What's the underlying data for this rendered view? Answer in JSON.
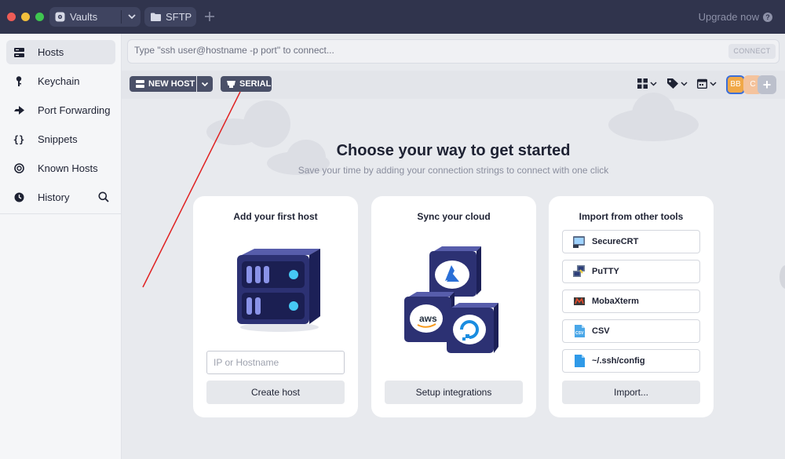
{
  "titlebar": {
    "tabs": [
      {
        "label": "Vaults",
        "icon": "vault-icon"
      },
      {
        "label": "SFTP",
        "icon": "folder-icon"
      }
    ],
    "new_tab_icon": "plus-icon",
    "upgrade_label": "Upgrade now"
  },
  "sidebar": {
    "items": [
      {
        "label": "Hosts",
        "icon": "hosts-icon",
        "active": true
      },
      {
        "label": "Keychain",
        "icon": "key-icon"
      },
      {
        "label": "Port Forwarding",
        "icon": "port-forwarding-icon"
      },
      {
        "label": "Snippets",
        "icon": "snippets-icon"
      },
      {
        "label": "Known Hosts",
        "icon": "known-hosts-icon"
      },
      {
        "label": "History",
        "icon": "history-icon"
      }
    ]
  },
  "command_bar": {
    "placeholder": "Type \"ssh user@hostname -p port\" to connect...",
    "connect_label": "CONNECT"
  },
  "toolbar": {
    "new_host_label": "NEW HOST",
    "serial_label": "SERIAL",
    "avatars": [
      "BB",
      "C",
      "+"
    ]
  },
  "hero": {
    "title": "Choose your way to get started",
    "subtitle": "Save your time by adding your connection strings to connect with one click"
  },
  "cards": {
    "host": {
      "title": "Add your first host",
      "input_placeholder": "IP or Hostname",
      "button_label": "Create host"
    },
    "cloud": {
      "title": "Sync your cloud",
      "button_label": "Setup integrations",
      "providers": [
        "Azure",
        "aws",
        "DigitalOcean"
      ],
      "aws_label": "aws"
    },
    "import": {
      "title": "Import from other tools",
      "tools": [
        "SecureCRT",
        "PuTTY",
        "MobaXterm",
        "CSV",
        "~/.ssh/config"
      ],
      "csv_icon_label": "CSV",
      "button_label": "Import..."
    }
  },
  "colors": {
    "titlebar": "#30344d",
    "sidebar": "#f5f6f8",
    "button_dark": "#4a5068",
    "accent_blue": "#3b6ed8",
    "server_purple": "#2a2f6b"
  }
}
